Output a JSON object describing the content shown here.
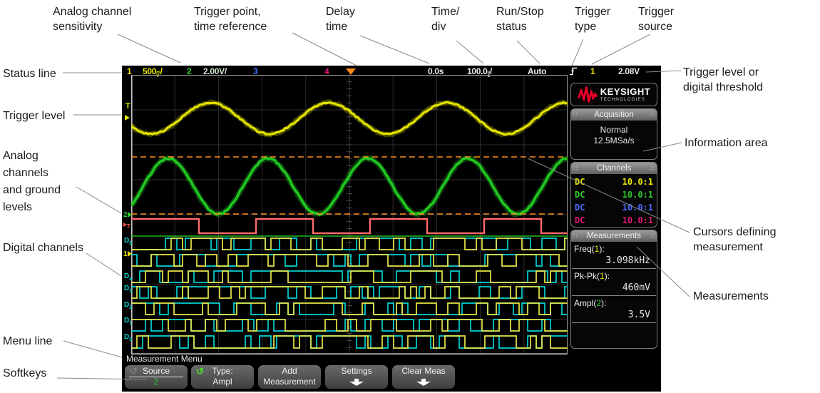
{
  "callouts": {
    "top": [
      {
        "text": "Analog channel\nsensitivity"
      },
      {
        "text": "Trigger point,\ntime reference"
      },
      {
        "text": "Delay\ntime"
      },
      {
        "text": "Time/\ndiv"
      },
      {
        "text": "Run/Stop\nstatus"
      },
      {
        "text": "Trigger\ntype"
      },
      {
        "text": "Trigger\nsource"
      }
    ],
    "left": [
      {
        "text": "Status line"
      },
      {
        "text": "Trigger level"
      },
      {
        "text": "Analog\nchannels\nand ground\nlevels"
      },
      {
        "text": "Digital channels"
      },
      {
        "text": "Menu line"
      },
      {
        "text": "Softkeys"
      }
    ],
    "right": [
      {
        "text": "Trigger level or\ndigital threshold"
      },
      {
        "text": "Information area"
      },
      {
        "text": "Cursors defining\nmeasurement"
      },
      {
        "text": "Measurements"
      }
    ]
  },
  "scope": {
    "status": {
      "ch1_num": "1",
      "ch1_sens": "500",
      "ch1_unit": [
        "m",
        "V"
      ],
      "ch1_slash": "/",
      "ch2_num": "2",
      "ch2_sens": "2.00V/",
      "ch3_num": "3",
      "ch4_num": "4",
      "delay": "0.0s",
      "timebase": "100.0",
      "tb_unit": [
        "µ",
        "s"
      ],
      "tb_slash": "/",
      "run_status": "Auto",
      "trigger_type_icon": "rising-edge",
      "trigger_source": "1",
      "trigger_level": "2.08V"
    },
    "logo": {
      "brand": "KEYSIGHT",
      "sub": "TECHNOLOGIES",
      "icon": "keysight-wave"
    },
    "acquisition": {
      "title": "Acquisition",
      "mode": "Normal",
      "rate": "12.5MSa/s"
    },
    "channels": {
      "title": "Channels",
      "rows": [
        {
          "coupling": "DC",
          "probe": "10.0:1",
          "color": "#e8e800"
        },
        {
          "coupling": "DC",
          "probe": "10.0:1",
          "color": "#2ecc2e"
        },
        {
          "coupling": "DC",
          "probe": "10.0:1",
          "color": "#4a6cff"
        },
        {
          "coupling": "DC",
          "probe": "10.0:1",
          "color": "#e01a78"
        }
      ]
    },
    "measurements": {
      "title": "Measurements",
      "rows": [
        {
          "pre": "Freq(",
          "chan": "1",
          "post": "):",
          "value": "3.098kHz",
          "chan_color": "#e8e800"
        },
        {
          "pre": "Pk-Pk(",
          "chan": "1",
          "post": "):",
          "value": "460mV",
          "chan_color": "#e8e800"
        },
        {
          "pre": "Ampl(",
          "chan": "2",
          "post": "):",
          "value": "3.5V",
          "chan_color": "#2ecc2e"
        }
      ]
    },
    "gutter": {
      "trigger_marker": "T",
      "ch1_ground": "1",
      "ch2_ground": "2",
      "d7": "7",
      "digital_labels": [
        {
          "d": "D",
          "n": "6"
        },
        {
          "d": "D",
          "n": "4"
        },
        {
          "d": "D",
          "n": "3"
        },
        {
          "d": "D",
          "n": "2"
        },
        {
          "d": "D",
          "n": "1"
        },
        {
          "d": "D",
          "n": "0"
        }
      ]
    },
    "menu_line": "Measurement Menu",
    "softkeys": [
      {
        "label": "Source",
        "value": "2",
        "value_color": "#2ecc2e",
        "icon": "cycle-arrow",
        "icon_color": "#7a7a7a",
        "icon_glyph": "↺"
      },
      {
        "label": "Type:",
        "value": "Ampl",
        "icon": "cycle-arrow",
        "icon_color": "#4ce022",
        "icon_glyph": "↺"
      },
      {
        "label": "Add",
        "value": "Measurement"
      },
      {
        "label": "Settings",
        "icon": "down-arrow"
      },
      {
        "label": "Clear Meas",
        "icon": "down-arrow"
      }
    ],
    "colors": {
      "ch1": "#e8e800",
      "ch2": "#22cc22",
      "ch3": "#4a6cff",
      "ch4": "#e01a78",
      "d7_trace": "#ff6a6a",
      "digital_yellow": "#e8e84a",
      "digital_cyan": "#00d4d4",
      "cursor": "#ff8c1a",
      "grid": "#2e2e2e",
      "border": "#c8c8c8",
      "logo_red": "#e90029"
    }
  }
}
